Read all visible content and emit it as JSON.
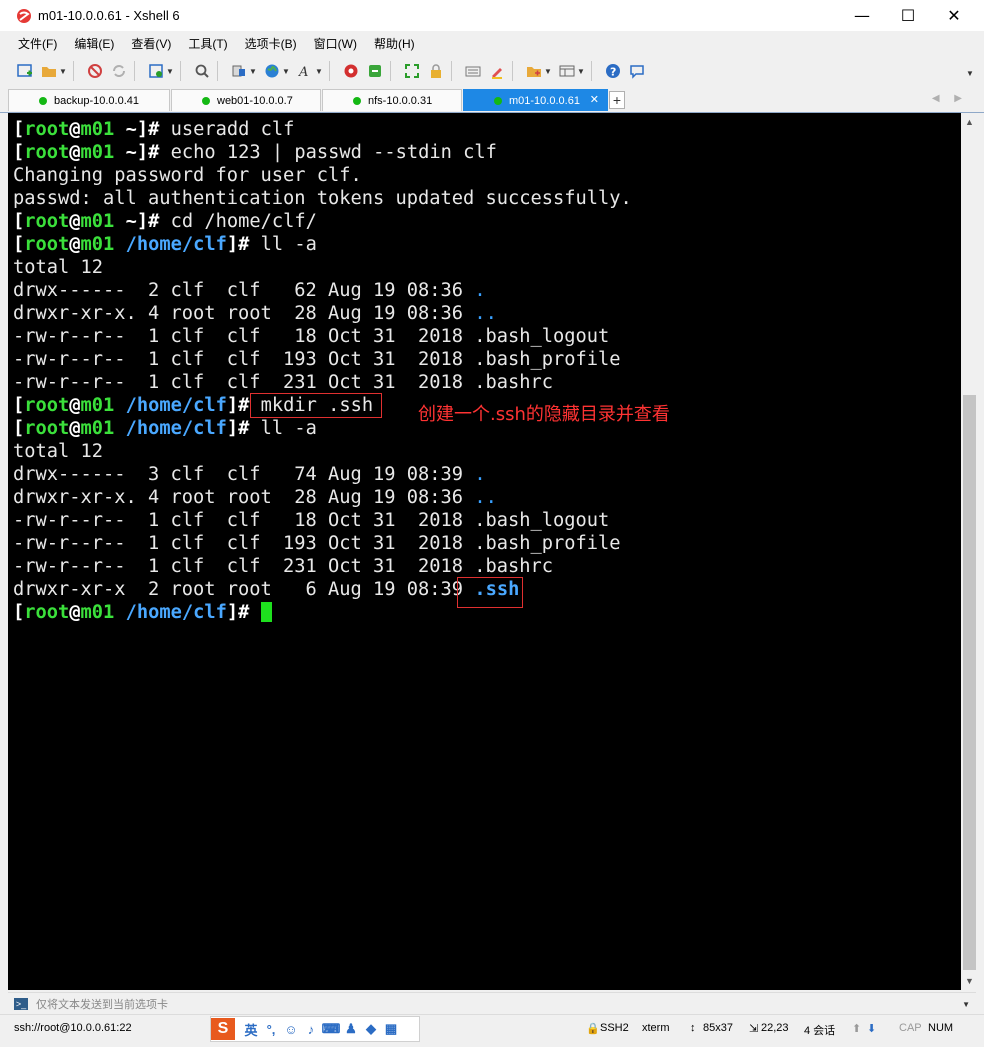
{
  "window": {
    "title": "m01-10.0.0.61 - Xshell 6",
    "minimize": "—",
    "maximize": "☐",
    "close": "✕"
  },
  "menu": [
    "文件(F)",
    "编辑(E)",
    "查看(V)",
    "工具(T)",
    "选项卡(B)",
    "窗口(W)",
    "帮助(H)"
  ],
  "tabs": [
    {
      "label": "backup-10.0.0.41",
      "active": false
    },
    {
      "label": "web01-10.0.0.7",
      "active": false
    },
    {
      "label": "nfs-10.0.0.31",
      "active": false
    },
    {
      "label": "m01-10.0.0.61",
      "active": true
    }
  ],
  "terminal": {
    "prompt": {
      "user": "root",
      "host": "m01",
      "home_dir": "~",
      "clf_dir": "/home/clf"
    },
    "lines": [
      "useradd clf",
      "echo 123 | passwd --stdin clf",
      "Changing password for user clf.",
      "passwd: all authentication tokens updated successfully.",
      "cd /home/clf/",
      "ll -a",
      "total 12",
      "drwx------  2 clf  clf   62 Aug 19 08:36",
      ".",
      "drwxr-xr-x. 4 root root  28 Aug 19 08:36",
      "..",
      "-rw-r--r--  1 clf  clf   18 Oct 31  2018 .bash_logout",
      "-rw-r--r--  1 clf  clf  193 Oct 31  2018 .bash_profile",
      "-rw-r--r--  1 clf  clf  231 Oct 31  2018 .bashrc",
      "mkdir .ssh",
      "ll -a",
      "total 12",
      "drwx------  3 clf  clf   74 Aug 19 08:39",
      ".",
      "drwxr-xr-x. 4 root root  28 Aug 19 08:36",
      "..",
      "-rw-r--r--  1 clf  clf   18 Oct 31  2018 .bash_logout",
      "-rw-r--r--  1 clf  clf  193 Oct 31  2018 .bash_profile",
      "-rw-r--r--  1 clf  clf  231 Oct 31  2018 .bashrc",
      "drwxr-xr-x  2 root root   6 Aug 19 08:39",
      ".ssh"
    ],
    "annotation": "创建一个.ssh的隐藏目录并查看"
  },
  "sendbar": {
    "placeholder": "仅将文本发送到当前选项卡"
  },
  "status": {
    "connection": "ssh://root@10.0.0.61:22",
    "protocol": "SSH2",
    "term": "xterm",
    "size": "85x37",
    "cursor": "22,23",
    "sessions": "4 会话",
    "caps": "CAP",
    "num": "NUM"
  },
  "ime": {
    "logo": "S",
    "lang": "英"
  },
  "colors": {
    "prompt_green": "#3be03b",
    "dir_blue": "#4aa8ff",
    "annotation_red": "#ff3333",
    "tab_active": "#1e88e5"
  }
}
